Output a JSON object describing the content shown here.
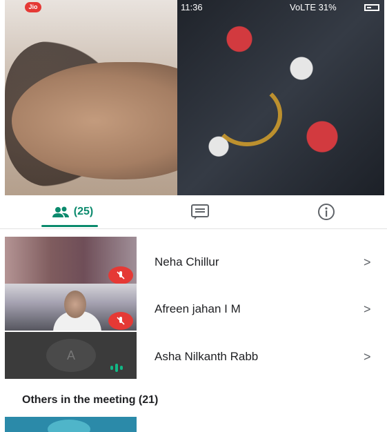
{
  "status_bar": {
    "carrier_badge": "Jio",
    "time": "11:36",
    "right_text": "VoLTE 31%",
    "battery_level": 0.31
  },
  "tabs": [
    {
      "name": "people",
      "label": "(25)",
      "icon": "people-icon",
      "active": true
    },
    {
      "name": "chat",
      "label": "",
      "icon": "chat-icon",
      "active": false
    },
    {
      "name": "info",
      "label": "",
      "icon": "info-icon",
      "active": false
    }
  ],
  "participants": [
    {
      "name": "Neha Chillur",
      "mic": "muted",
      "chevron": ">"
    },
    {
      "name": "Afreen jahan I M",
      "mic": "muted",
      "chevron": ">"
    },
    {
      "name": "Asha Nilkanth Rabb",
      "mic": "talking",
      "avatar_letter": "A",
      "chevron": ">"
    }
  ],
  "others_title": "Others in the meeting (21)",
  "colors": {
    "accent": "#0b8a6d",
    "mute": "#e53935",
    "talking": "#12b886"
  }
}
